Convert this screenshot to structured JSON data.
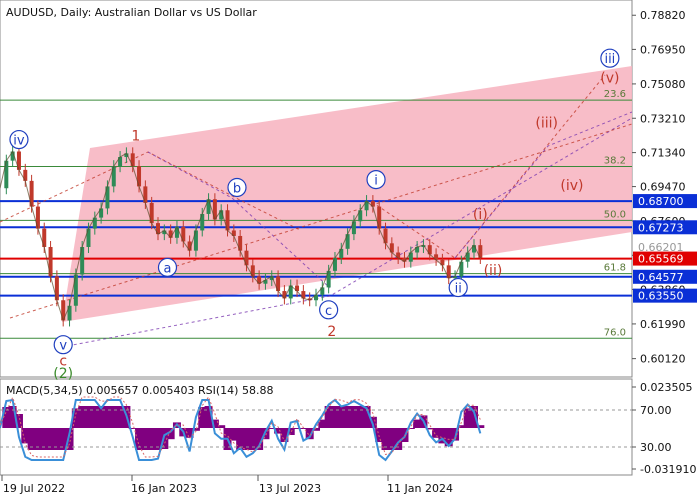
{
  "header": {
    "title": "AUDUSD, Daily:  Australian Dollar vs US Dollar"
  },
  "colors": {
    "price_up": "#2e8b57",
    "price_down": "#c0392b",
    "channel_fill": "#f7b6c2",
    "support_line": "#0a2fd6",
    "current_price_line": "#e00000",
    "wave_blue": "#1f3fbf",
    "wave_red": "#c0392b",
    "wave_green": "#3a8a2a",
    "fib_line": "#3a8a3a",
    "macd_hist": "#800080",
    "macd_signal": "#d96a6a",
    "rsi_line": "#3a8fd8"
  },
  "chart_data": [
    {
      "type": "line",
      "name": "price-panel",
      "title": "AUDUSD, Daily:  Australian Dollar vs US Dollar",
      "ylim": [
        0.5912,
        0.7965
      ],
      "x_ticks": [
        "19 Jul 2022",
        "16 Jan 2023",
        "13 Jul 2023",
        "11 Jan 2024"
      ],
      "y_ticks": [
        0.7882,
        0.7696,
        0.7508,
        0.7321,
        0.7134,
        0.6949,
        0.6762,
        0.6575,
        0.6389,
        0.6201,
        0.6012
      ],
      "y_tick_labels": [
        "0.78820",
        "0.76950",
        "0.75080",
        "0.73210",
        "0.71340",
        "0.69470",
        "0.67600",
        "0.65730",
        "0.63860",
        "0.61990",
        "0.60120"
      ],
      "price_labels": [
        {
          "value": 0.687,
          "label": "0.68700",
          "kind": "support"
        },
        {
          "value": 0.67273,
          "label": "0.67273",
          "kind": "support"
        },
        {
          "value": 0.662,
          "label": "0.66201",
          "kind": "price"
        },
        {
          "value": 0.65569,
          "label": "0.65569",
          "kind": "current"
        },
        {
          "value": 0.64577,
          "label": "0.64577",
          "kind": "support"
        },
        {
          "value": 0.6355,
          "label": "0.63550",
          "kind": "support"
        }
      ],
      "fib_levels": [
        {
          "label": "23.6",
          "value": 0.742
        },
        {
          "label": "38.2",
          "value": 0.7058
        },
        {
          "label": "50.0",
          "value": 0.6765
        },
        {
          "label": "61.8",
          "value": 0.6475
        },
        {
          "label": "76.0",
          "value": 0.6123
        }
      ],
      "wave_labels": [
        {
          "text": "iv",
          "circled": true,
          "color": "blue",
          "x": 0.03,
          "y": 0.7205
        },
        {
          "text": "v",
          "circled": true,
          "color": "blue",
          "x": 0.1,
          "y": 0.6088
        },
        {
          "text": "c",
          "circled": false,
          "color": "red",
          "x": 0.1,
          "y": 0.6002
        },
        {
          "text": "(2)",
          "circled": false,
          "color": "green",
          "x": 0.1,
          "y": 0.5935
        },
        {
          "text": "1",
          "circled": false,
          "color": "red",
          "x": 0.215,
          "y": 0.7228
        },
        {
          "text": "a",
          "circled": true,
          "color": "blue",
          "x": 0.265,
          "y": 0.6509
        },
        {
          "text": "b",
          "circled": true,
          "color": "blue",
          "x": 0.375,
          "y": 0.6944
        },
        {
          "text": "c",
          "circled": true,
          "color": "blue",
          "x": 0.52,
          "y": 0.6278
        },
        {
          "text": "2",
          "circled": false,
          "color": "red",
          "x": 0.525,
          "y": 0.6162
        },
        {
          "text": "i",
          "circled": true,
          "color": "blue",
          "x": 0.595,
          "y": 0.6987
        },
        {
          "text": "(i)",
          "circled": false,
          "color": "red",
          "x": 0.76,
          "y": 0.6799
        },
        {
          "text": "ii",
          "circled": true,
          "color": "blue",
          "x": 0.725,
          "y": 0.6399
        },
        {
          "text": "(ii)",
          "circled": false,
          "color": "red",
          "x": 0.78,
          "y": 0.6495
        },
        {
          "text": "(iii)",
          "circled": false,
          "color": "red",
          "x": 0.865,
          "y": 0.7297
        },
        {
          "text": "(iv)",
          "circled": false,
          "color": "red",
          "x": 0.905,
          "y": 0.6958
        },
        {
          "text": "(v)",
          "circled": false,
          "color": "red",
          "x": 0.965,
          "y": 0.7542
        },
        {
          "text": "iii",
          "circled": true,
          "color": "blue",
          "x": 0.965,
          "y": 0.7648
        }
      ],
      "series": [
        {
          "name": "AUDUSD",
          "x": [
            0.0,
            0.01,
            0.02,
            0.03,
            0.04,
            0.05,
            0.06,
            0.07,
            0.08,
            0.09,
            0.1,
            0.11,
            0.12,
            0.13,
            0.14,
            0.15,
            0.16,
            0.17,
            0.18,
            0.19,
            0.2,
            0.21,
            0.22,
            0.23,
            0.24,
            0.25,
            0.26,
            0.27,
            0.28,
            0.29,
            0.3,
            0.31,
            0.32,
            0.33,
            0.34,
            0.35,
            0.36,
            0.37,
            0.38,
            0.39,
            0.4,
            0.41,
            0.42,
            0.43,
            0.44,
            0.45,
            0.46,
            0.47,
            0.48,
            0.49,
            0.5,
            0.51,
            0.52,
            0.53,
            0.54,
            0.55,
            0.56,
            0.57,
            0.58,
            0.59,
            0.6,
            0.61,
            0.62,
            0.63,
            0.64,
            0.65,
            0.66,
            0.67,
            0.68,
            0.69,
            0.7,
            0.71,
            0.72,
            0.73,
            0.74,
            0.75,
            0.76
          ],
          "values": [
            0.694,
            0.709,
            0.714,
            0.704,
            0.698,
            0.684,
            0.672,
            0.662,
            0.646,
            0.633,
            0.622,
            0.63,
            0.647,
            0.662,
            0.672,
            0.678,
            0.683,
            0.695,
            0.706,
            0.711,
            0.713,
            0.706,
            0.695,
            0.686,
            0.675,
            0.669,
            0.671,
            0.667,
            0.673,
            0.665,
            0.66,
            0.671,
            0.68,
            0.688,
            0.677,
            0.682,
            0.671,
            0.668,
            0.66,
            0.652,
            0.646,
            0.642,
            0.644,
            0.646,
            0.638,
            0.634,
            0.641,
            0.638,
            0.634,
            0.633,
            0.636,
            0.64,
            0.649,
            0.656,
            0.661,
            0.669,
            0.676,
            0.682,
            0.687,
            0.684,
            0.672,
            0.664,
            0.659,
            0.656,
            0.654,
            0.659,
            0.662,
            0.663,
            0.658,
            0.655,
            0.652,
            0.645,
            0.646,
            0.654,
            0.659,
            0.663,
            0.656
          ]
        }
      ]
    },
    {
      "type": "line",
      "name": "indicator-panel",
      "title": "MACD(5,34,5) 0.005657 0.005403 RSI(14) 58.88",
      "y_tick_labels": [
        "0.023505",
        "70.00",
        "30.00",
        "-0.031910"
      ],
      "ylim": [
        -0.03191,
        0.023505
      ],
      "series": [
        {
          "name": "MACD(5,34,5)",
          "last": 0.005657
        },
        {
          "name": "Signal",
          "last": 0.005403
        },
        {
          "name": "RSI(14)",
          "last": 58.88
        }
      ]
    }
  ]
}
